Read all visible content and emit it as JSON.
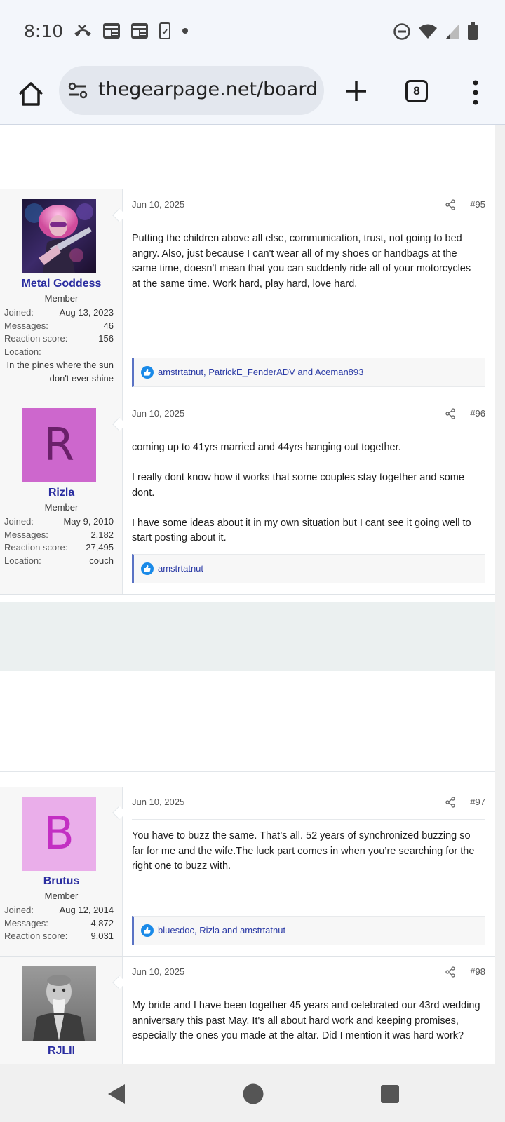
{
  "status_bar": {
    "time": "8:10",
    "left_icons": [
      "missed-call-icon",
      "news-icon",
      "news-icon",
      "sim-icon",
      "dot-icon"
    ],
    "right_icons": [
      "dnd-icon",
      "wifi-icon",
      "signal-icon",
      "battery-icon"
    ]
  },
  "browser": {
    "url": "thegearpage.net/board/",
    "tab_count": "8"
  },
  "posts": [
    {
      "author": "Metal Goddess",
      "title": "Member",
      "avatar_type": "image",
      "stats": [
        {
          "label": "Joined:",
          "value": "Aug 13, 2023"
        },
        {
          "label": "Messages:",
          "value": "46"
        },
        {
          "label": "Reaction score:",
          "value": "156"
        },
        {
          "label": "Location:",
          "value": ""
        }
      ],
      "location": "In the pines where the sun don't ever shine",
      "date": "Jun 10, 2025",
      "number": "#95",
      "paragraphs": [
        "Putting the children above all else, communication, trust, not going to bed angry. Also, just because I can't wear all of my shoes or handbags at the same time, doesn't mean that you can suddenly ride all of your motorcycles at the same time. Work hard, play hard, love hard."
      ],
      "reactions": "amstrtatnut, PatrickE_FenderADV and Aceman893"
    },
    {
      "author": "Rizla",
      "title": "Member",
      "avatar_letter": "R",
      "stats": [
        {
          "label": "Joined:",
          "value": "May 9, 2010"
        },
        {
          "label": "Messages:",
          "value": "2,182"
        },
        {
          "label": "Reaction score:",
          "value": "27,495"
        },
        {
          "label": "Location:",
          "value": "couch"
        }
      ],
      "date": "Jun 10, 2025",
      "number": "#96",
      "paragraphs": [
        "coming up to 41yrs married and 44yrs hanging out together.",
        "I really dont know how it works that some couples stay together and some dont.",
        "I have some ideas about it in my own situation but I cant see it going well to start posting about it."
      ],
      "reactions": "amstrtatnut"
    },
    {
      "author": "Brutus",
      "title": "Member",
      "avatar_letter": "B",
      "stats": [
        {
          "label": "Joined:",
          "value": "Aug 12, 2014"
        },
        {
          "label": "Messages:",
          "value": "4,872"
        },
        {
          "label": "Reaction score:",
          "value": "9,031"
        }
      ],
      "date": "Jun 10, 2025",
      "number": "#97",
      "paragraphs": [
        "You have to buzz the same. That’s all. 52 years of synchronized buzzing so far for me and the wife.The luck part comes in when you’re searching for the right one to buzz with."
      ],
      "reactions": "bluesdoc, Rizla and amstrtatnut"
    },
    {
      "author": "RJLII",
      "avatar_type": "image",
      "date": "Jun 10, 2025",
      "number": "#98",
      "paragraphs": [
        "My bride and I have been together 45 years and celebrated our 43rd wedding anniversary this past May. It's all about hard work and keeping promises, especially the ones you made at the altar. Did I mention it was hard work?"
      ]
    }
  ],
  "colors": {
    "username": "#2a2da0",
    "rizla_avatar_bg": "#cd67cd",
    "rizla_avatar_fg": "#6a206a",
    "brutus_avatar_bg": "#eaaeea",
    "brutus_avatar_fg": "#c32fc3",
    "reaction_accent": "#5a73c4"
  }
}
